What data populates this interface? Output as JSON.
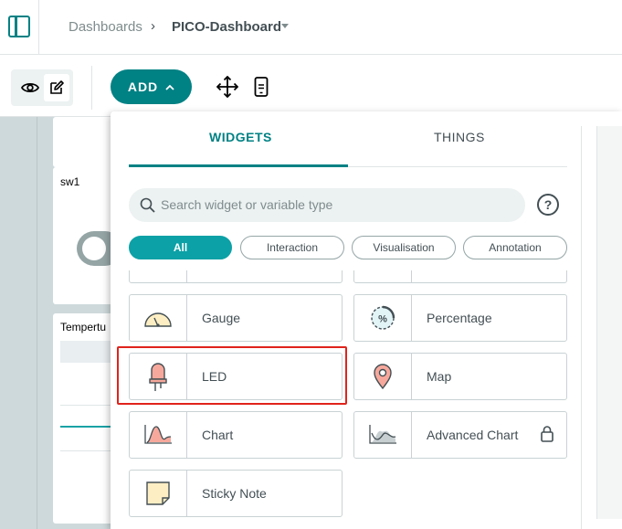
{
  "breadcrumb": {
    "root": "Dashboards",
    "current": "PICO-Dashboard"
  },
  "toolbar": {
    "add_label": "ADD"
  },
  "dashboard": {
    "cards": [
      {
        "title": "sw1"
      },
      {
        "title": "Tempertu"
      }
    ]
  },
  "popover": {
    "tabs": [
      {
        "label": "WIDGETS",
        "active": true
      },
      {
        "label": "THINGS",
        "active": false
      }
    ],
    "search": {
      "placeholder": "Search widget or variable type"
    },
    "help_label": "?",
    "filters": [
      {
        "label": "All",
        "active": true
      },
      {
        "label": "Interaction",
        "active": false
      },
      {
        "label": "Visualisation",
        "active": false
      },
      {
        "label": "Annotation",
        "active": false
      }
    ],
    "widgets": [
      {
        "label": "Gauge",
        "icon": "gauge-icon"
      },
      {
        "label": "Percentage",
        "icon": "percentage-icon"
      },
      {
        "label": "LED",
        "icon": "led-icon",
        "highlighted": true
      },
      {
        "label": "Map",
        "icon": "map-pin-icon"
      },
      {
        "label": "Chart",
        "icon": "chart-icon"
      },
      {
        "label": "Advanced Chart",
        "icon": "advanced-chart-icon",
        "locked": true
      },
      {
        "label": "Sticky Note",
        "icon": "sticky-note-icon"
      }
    ],
    "percentage_icon_text": "%"
  },
  "colors": {
    "accent": "#008184",
    "filter_active": "#0ca1a6",
    "highlight": "#e0231c"
  }
}
